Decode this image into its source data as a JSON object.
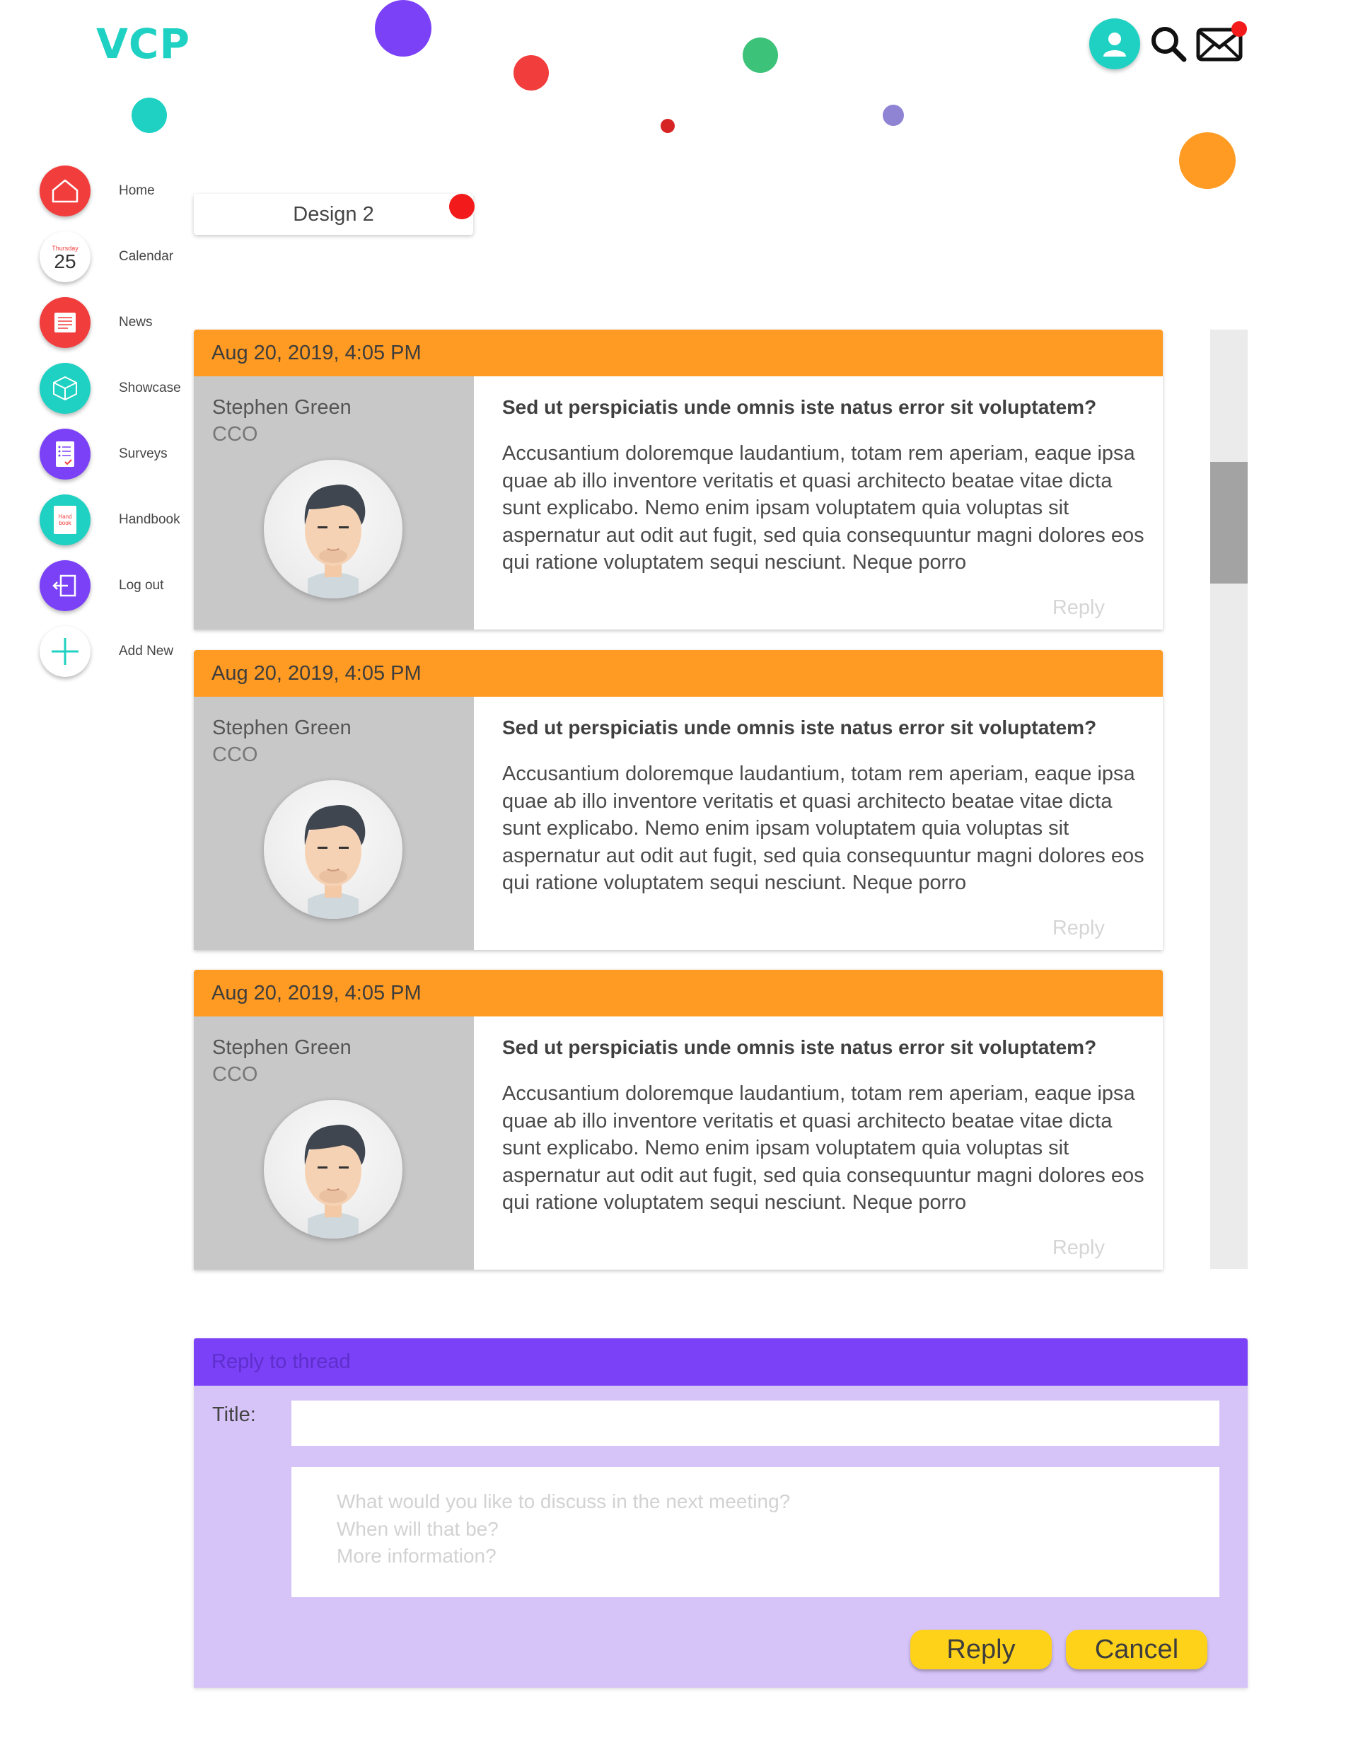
{
  "app": {
    "logo": "VCP"
  },
  "header": {
    "icons": [
      "user-icon",
      "search-icon",
      "mail-icon"
    ],
    "mail_has_notification": true
  },
  "sidebar": {
    "items": [
      {
        "label": "Home",
        "icon": "home-icon",
        "color": "#f23d3d"
      },
      {
        "label": "Calendar",
        "icon": "calendar-icon",
        "color": "#ffffff",
        "day_name": "Thursday",
        "day_number": "25"
      },
      {
        "label": "News",
        "icon": "news-icon",
        "color": "#f23d3d"
      },
      {
        "label": "Showcase",
        "icon": "cube-icon",
        "color": "#1fd1c2"
      },
      {
        "label": "Surveys",
        "icon": "survey-icon",
        "color": "#7b41f7"
      },
      {
        "label": "Handbook",
        "icon": "handbook-icon",
        "color": "#1fd1c2",
        "icon_text": "Hand book"
      },
      {
        "label": "Log out",
        "icon": "logout-icon",
        "color": "#7b41f7"
      },
      {
        "label": "Add New",
        "icon": "plus-icon",
        "color": "#ffffff"
      }
    ]
  },
  "tab": {
    "label": "Design 2"
  },
  "posts": [
    {
      "date": "Aug 20, 2019, 4:05 PM",
      "author": "Stephen Green",
      "role": "CCO",
      "title": "Sed ut perspiciatis unde omnis iste natus error sit voluptatem?",
      "body": "Accusantium doloremque laudantium, totam rem aperiam, eaque ipsa quae ab illo inventore veritatis et quasi architecto beatae vitae dicta sunt explicabo. Nemo enim ipsam voluptatem quia voluptas sit aspernatur aut odit aut fugit, sed quia consequuntur magni dolores eos qui ratione voluptatem sequi nesciunt. Neque porro",
      "reply_label": "Reply"
    },
    {
      "date": "Aug 20, 2019, 4:05 PM",
      "author": "Stephen Green",
      "role": "CCO",
      "title": "Sed ut perspiciatis unde omnis iste natus error sit voluptatem?",
      "body": "Accusantium doloremque laudantium, totam rem aperiam, eaque ipsa quae ab illo inventore veritatis et quasi architecto beatae vitae dicta sunt explicabo. Nemo enim ipsam voluptatem quia voluptas sit aspernatur aut odit aut fugit, sed quia consequuntur magni dolores eos qui ratione voluptatem sequi nesciunt. Neque porro",
      "reply_label": "Reply"
    },
    {
      "date": "Aug 20, 2019, 4:05 PM",
      "author": "Stephen Green",
      "role": "CCO",
      "title": "Sed ut perspiciatis unde omnis iste natus error sit voluptatem?",
      "body": "Accusantium doloremque laudantium, totam rem aperiam, eaque ipsa quae ab illo inventore veritatis et quasi architecto beatae vitae dicta sunt explicabo. Nemo enim ipsam voluptatem quia voluptas sit aspernatur aut odit aut fugit, sed quia consequuntur magni dolores eos qui ratione voluptatem sequi nesciunt. Neque porro",
      "reply_label": "Reply"
    }
  ],
  "reply_form": {
    "header": "Reply to thread",
    "title_label": "Title:",
    "title_value": "",
    "message_placeholder": "What would you like to discuss in the next meeting?\nWhen will that be?\nMore information?",
    "reply_button": "Reply",
    "cancel_button": "Cancel"
  },
  "colors": {
    "accent_teal": "#1fd1c2",
    "accent_orange": "#ff9a22",
    "accent_purple": "#7b41f7",
    "accent_red": "#f23d3d",
    "button_yellow": "#ffd21a"
  }
}
